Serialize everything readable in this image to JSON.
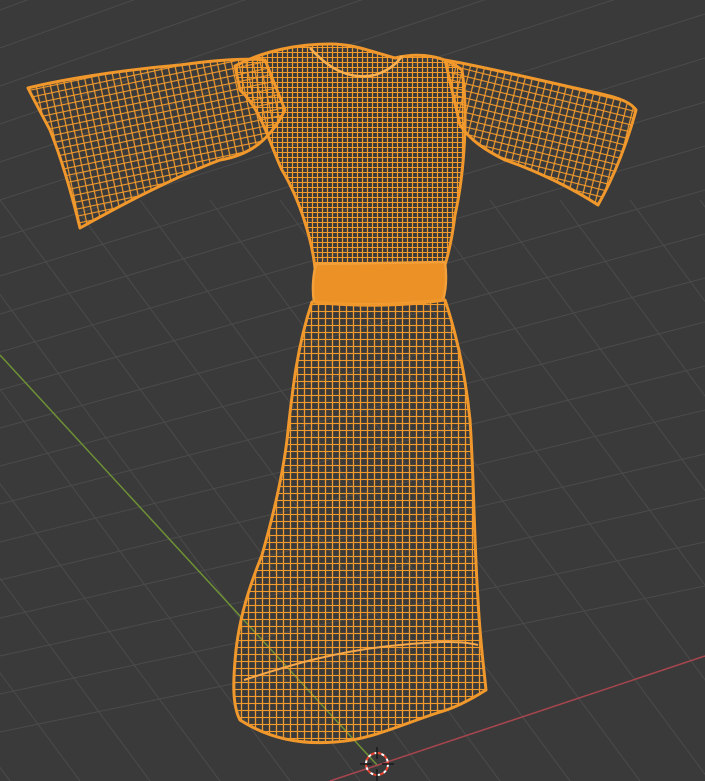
{
  "viewport": {
    "mode": "wireframe",
    "object": "dress",
    "object_edit_state": "selected",
    "icons": [
      "3d-cursor-icon"
    ]
  },
  "colors": {
    "background": "#3a3a3a",
    "grid_line": "#4b4b4b",
    "x_axis": "#a8454f",
    "y_axis": "#6e9135",
    "wire_selected": "#f0982c",
    "wire_fill": "#e08a22",
    "cursor_red": "#e8432f",
    "cursor_white": "#ffffff"
  }
}
